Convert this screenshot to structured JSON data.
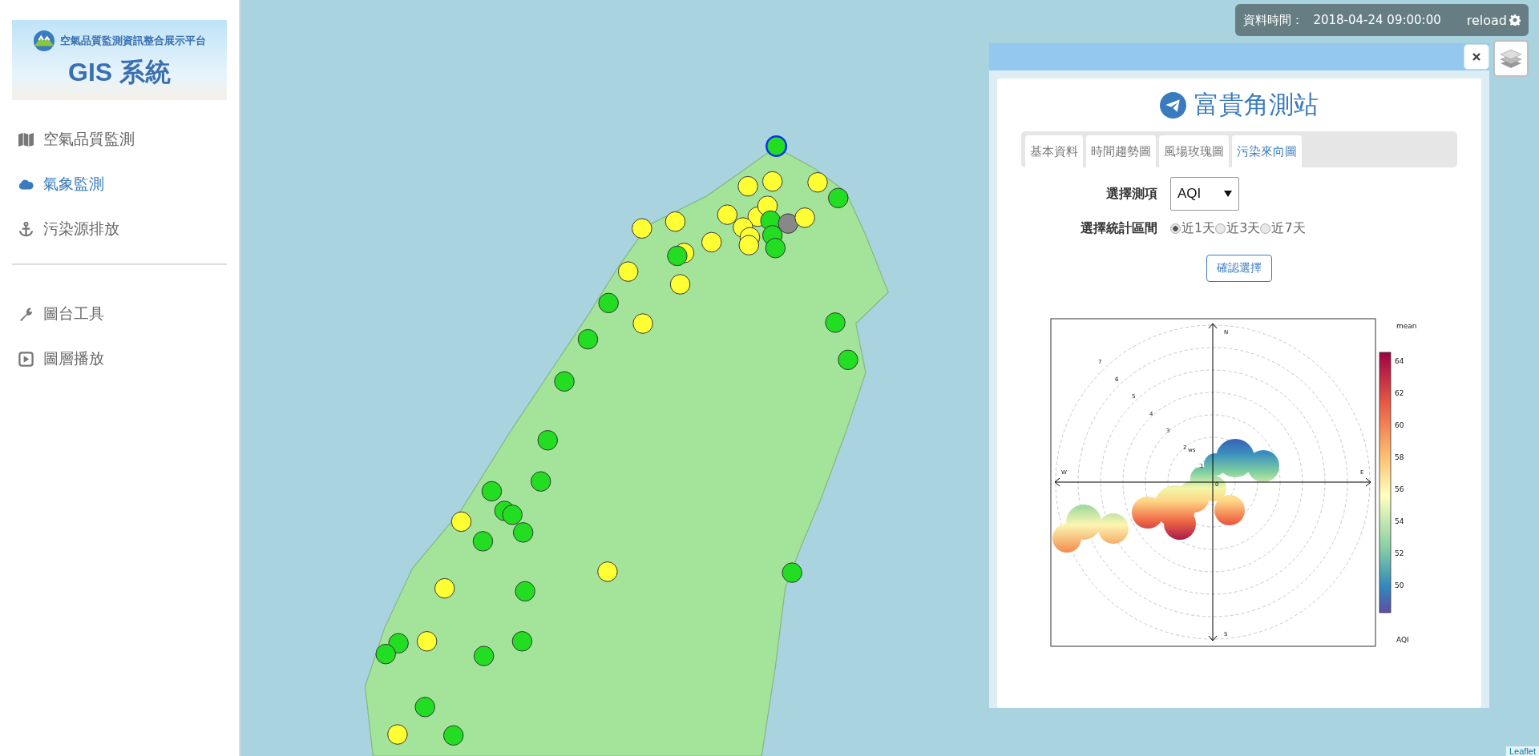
{
  "sidebar": {
    "logo": {
      "subtitle": "空氣品質監測資訊整合展示平台",
      "title": "GIS 系統"
    },
    "menu": [
      {
        "kind": "map",
        "label": "空氣品質監測",
        "selected": false
      },
      {
        "kind": "cloud",
        "label": "氣象監測",
        "selected": true
      },
      {
        "kind": "anchor",
        "label": "污染源排放",
        "selected": false
      }
    ],
    "tools": [
      {
        "kind": "wrench",
        "label": "圖台工具",
        "selected": false
      },
      {
        "kind": "play",
        "label": "圖層播放",
        "selected": false
      }
    ]
  },
  "data_time": {
    "label": "資料時間：",
    "value": "2018-04-24 09:00:00",
    "reload": "reload"
  },
  "stations": [
    {
      "color": "#22dd22",
      "selected": true
    },
    {
      "color": "#ffff33",
      "selected": false
    },
    {
      "color": "#ffff33",
      "selected": false
    },
    {
      "color": "#ffff33",
      "selected": false
    },
    {
      "color": "#22dd22",
      "selected": false
    },
    {
      "color": "#ffff33",
      "selected": false
    },
    {
      "color": "#ffff33",
      "selected": false
    },
    {
      "color": "#ffff33",
      "selected": false
    },
    {
      "color": "#22dd22",
      "selected": false
    },
    {
      "color": "#888888",
      "selected": false
    },
    {
      "color": "#ffff33",
      "selected": false
    },
    {
      "color": "#ffff33",
      "selected": false
    },
    {
      "color": "#ffff33",
      "selected": false
    },
    {
      "color": "#22dd22",
      "selected": false
    },
    {
      "color": "#22dd22",
      "selected": false
    },
    {
      "color": "#ffff33",
      "selected": false
    },
    {
      "color": "#ffff33",
      "selected": false
    },
    {
      "color": "#ffff33",
      "selected": false
    },
    {
      "color": "#ffff33",
      "selected": false
    },
    {
      "color": "#ffff33",
      "selected": false
    },
    {
      "color": "#22dd22",
      "selected": false
    },
    {
      "color": "#ffff33",
      "selected": false
    },
    {
      "color": "#ffff33",
      "selected": false
    },
    {
      "color": "#22dd22",
      "selected": false
    },
    {
      "color": "#ffff33",
      "selected": false
    },
    {
      "color": "#22dd22",
      "selected": false
    },
    {
      "color": "#22dd22",
      "selected": false
    },
    {
      "color": "#22dd22",
      "selected": false
    },
    {
      "color": "#22dd22",
      "selected": false
    },
    {
      "color": "#22dd22",
      "selected": false
    },
    {
      "color": "#22dd22",
      "selected": false
    },
    {
      "color": "#22dd22",
      "selected": false
    },
    {
      "color": "#22dd22",
      "selected": false
    },
    {
      "color": "#22dd22",
      "selected": false
    },
    {
      "color": "#ffff33",
      "selected": false
    },
    {
      "color": "#22dd22",
      "selected": false
    },
    {
      "color": "#22dd22",
      "selected": false
    },
    {
      "color": "#ffff33",
      "selected": false
    },
    {
      "color": "#22dd22",
      "selected": false
    },
    {
      "color": "#ffff33",
      "selected": false
    },
    {
      "color": "#22dd22",
      "selected": false
    },
    {
      "color": "#22dd22",
      "selected": false
    },
    {
      "color": "#22dd22",
      "selected": false
    },
    {
      "color": "#ffff33",
      "selected": false
    },
    {
      "color": "#22dd22",
      "selected": false
    },
    {
      "color": "#22dd22",
      "selected": false
    },
    {
      "color": "#22dd22",
      "selected": false
    },
    {
      "color": "#ffff33",
      "selected": false
    },
    {
      "color": "#22dd22",
      "selected": false
    }
  ],
  "station_panel": {
    "title": "富貴角測站",
    "tabs": [
      {
        "label": "基本資料",
        "selected": false
      },
      {
        "label": "時間趨勢圖",
        "selected": false
      },
      {
        "label": "風場玫瑰圖",
        "selected": false
      },
      {
        "label": "污染來向圖",
        "selected": true
      }
    ],
    "item_label": "選擇測項",
    "item_value": "AQI",
    "period_label": "選擇統計區間",
    "periods": [
      {
        "label": "近1天",
        "selected": true
      },
      {
        "label": "近3天",
        "selected": false
      },
      {
        "label": "近7天",
        "selected": false
      }
    ],
    "confirm": "確認選擇",
    "polar_plot": {
      "directions": [
        "N",
        "E",
        "S",
        "W"
      ],
      "rings": [
        "1",
        "2",
        "3",
        "4",
        "5",
        "6",
        "7"
      ],
      "origin": "0",
      "ws_label": "ws",
      "legend_title": "mean",
      "legend_ticks": [
        "64",
        "62",
        "60",
        "58",
        "56",
        "54",
        "52",
        "50"
      ],
      "legend_unit": "AQI"
    }
  },
  "attribution": "Leaflet"
}
